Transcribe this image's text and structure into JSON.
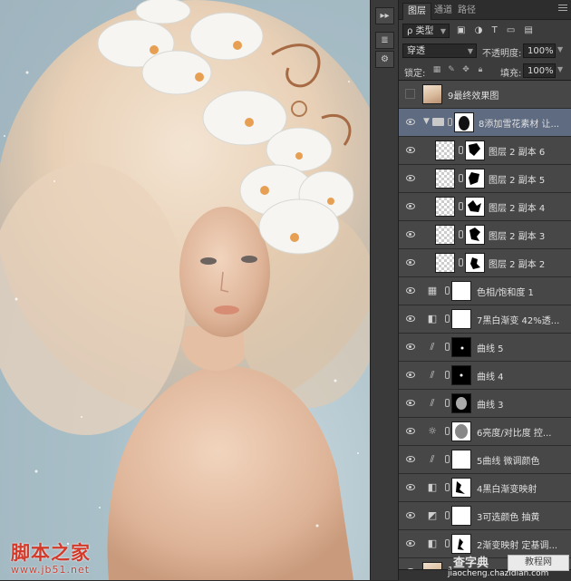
{
  "watermark": {
    "cn": "脚本之家",
    "url": "www.jb51.net"
  },
  "site_watermark": {
    "name": "查字典",
    "badge": "教程网",
    "url": "jiaocheng.chazidian.com"
  },
  "toolbar": {
    "buttons": [
      {
        "icon": "expand-panels-icon",
        "label": "▸▸"
      },
      {
        "icon": "layers-icon",
        "label": "≣"
      },
      {
        "icon": "adjust-icon",
        "label": "⚙"
      }
    ]
  },
  "panel": {
    "tabs": [
      "图层",
      "通道",
      "路径"
    ],
    "active_tab": "图层",
    "filter": {
      "kind": "ρ 类型",
      "icons": [
        "image-filter-icon",
        "adjust-filter-icon",
        "type-filter-icon",
        "shape-filter-icon",
        "smart-filter-icon"
      ]
    },
    "blend_mode": "穿透",
    "opacity_label": "不透明度:",
    "opacity": "100%",
    "lock_label": "锁定:",
    "fill_label": "填充:",
    "fill": "100%",
    "layers": [
      {
        "name": "9最终效果图",
        "kind": "photo",
        "visible": false
      },
      {
        "name": "8添加雪花素材 让...",
        "kind": "group",
        "visible": true,
        "selected": true
      },
      {
        "name": "图层 2 副本 6",
        "kind": "pixel",
        "visible": true,
        "indent": true
      },
      {
        "name": "图层 2 副本 5",
        "kind": "pixel",
        "visible": true,
        "indent": true
      },
      {
        "name": "图层 2 副本 4",
        "kind": "pixel",
        "visible": true,
        "indent": true
      },
      {
        "name": "图层 2 副本 3",
        "kind": "pixel",
        "visible": true,
        "indent": true
      },
      {
        "name": "图层 2 副本 2",
        "kind": "pixel",
        "visible": true,
        "indent": true
      },
      {
        "name": "色相/饱和度 1",
        "kind": "adjust",
        "icon": "hue-sat-icon",
        "visible": true
      },
      {
        "name": "7黑白渐变 42%透...",
        "kind": "adjust",
        "icon": "gradient-map-icon",
        "visible": true
      },
      {
        "name": "曲线 5",
        "kind": "adjust",
        "icon": "curves-icon",
        "visible": true
      },
      {
        "name": "曲线 4",
        "kind": "adjust",
        "icon": "curves-icon",
        "visible": true
      },
      {
        "name": "曲线 3",
        "kind": "adjust",
        "icon": "curves-icon",
        "visible": true
      },
      {
        "name": "6亮度/对比度  控...",
        "kind": "adjust",
        "icon": "brightness-icon",
        "visible": true
      },
      {
        "name": "5曲线  微调颜色",
        "kind": "adjust",
        "icon": "curves-icon",
        "visible": true
      },
      {
        "name": "4黑白渐变映射",
        "kind": "adjust",
        "icon": "gradient-map-icon",
        "visible": true
      },
      {
        "name": "3可选颜色  抽黄",
        "kind": "adjust",
        "icon": "selective-color-icon",
        "visible": true
      },
      {
        "name": "2渐变映射 定基调...",
        "kind": "adjust",
        "icon": "gradient-map-icon",
        "visible": true
      },
      {
        "name": "1",
        "kind": "photo",
        "visible": true
      }
    ]
  },
  "colors": {
    "panel_bg": "#3c3c3c",
    "selected_row": "#5e6b80",
    "watermark_red": "#d43a2a"
  }
}
